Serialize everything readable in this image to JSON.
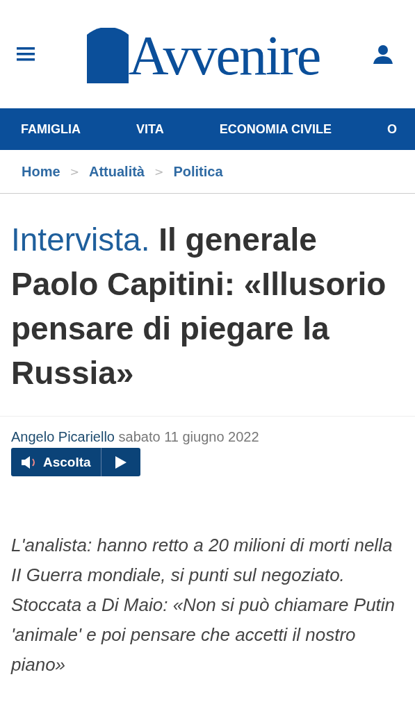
{
  "header": {
    "logo": "Avvenire"
  },
  "nav": [
    {
      "label": "FAMIGLIA"
    },
    {
      "label": "VITA"
    },
    {
      "label": "ECONOMIA CIVILE"
    },
    {
      "label": "O"
    }
  ],
  "breadcrumb": [
    {
      "label": "Home",
      "separator": ">"
    },
    {
      "label": "Attualità",
      "separator": ">"
    },
    {
      "label": "Politica"
    }
  ],
  "article": {
    "kicker": "Intervista.",
    "title": "Il generale Paolo Capitini: «Illusorio pensare di piegare la Russia»",
    "author": "Angelo Picariello",
    "date": "sabato 11 giugno 2022",
    "listen": "Ascolta",
    "summary": "L'analista: hanno retto a 20 milioni di morti nella II Guerra mondiale, si punti sul negoziato. Stoccata a Di Maio: «Non si può chiamare Putin 'animale' e poi pensare che accetti il nostro piano»"
  }
}
